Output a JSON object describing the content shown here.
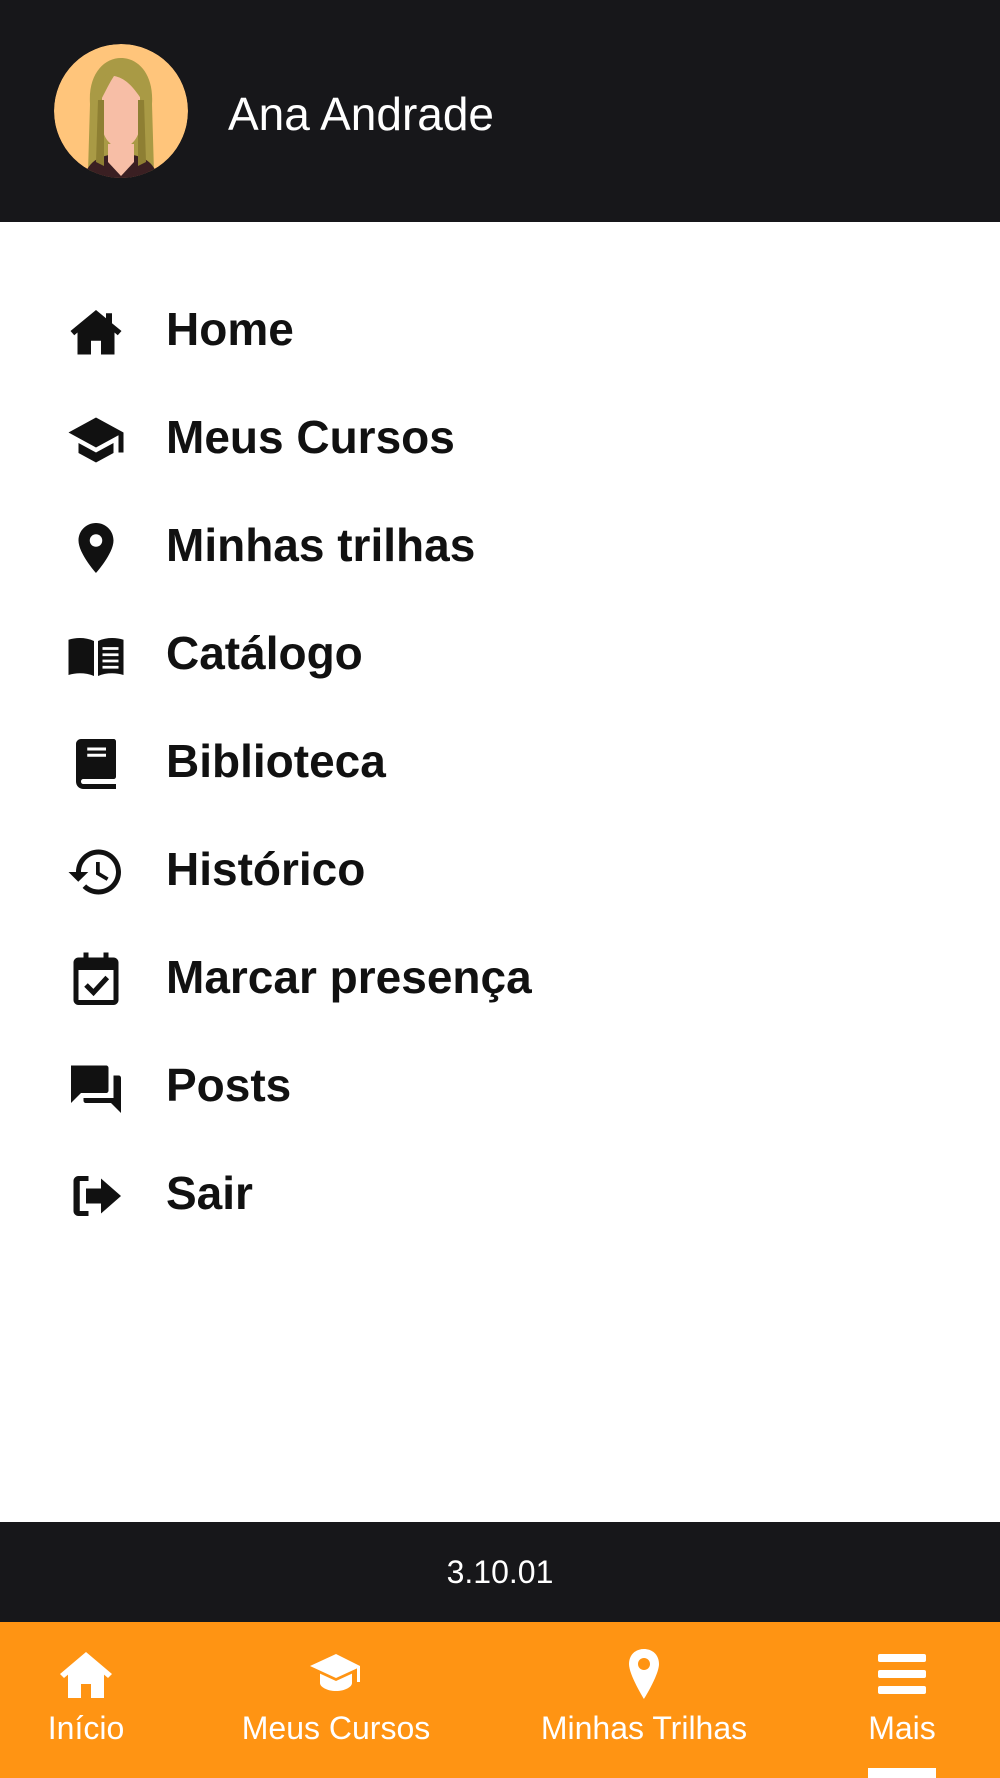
{
  "header": {
    "user_name": "Ana Andrade"
  },
  "menu": {
    "items": [
      {
        "label": "Home",
        "icon": "home-icon"
      },
      {
        "label": "Meus Cursos",
        "icon": "graduation-cap-icon"
      },
      {
        "label": "Minhas trilhas",
        "icon": "map-pin-icon"
      },
      {
        "label": "Catálogo",
        "icon": "open-book-icon"
      },
      {
        "label": "Biblioteca",
        "icon": "book-icon"
      },
      {
        "label": "Histórico",
        "icon": "history-icon"
      },
      {
        "label": "Marcar presença",
        "icon": "calendar-check-icon"
      },
      {
        "label": "Posts",
        "icon": "forum-icon"
      },
      {
        "label": "Sair",
        "icon": "sign-out-icon"
      }
    ]
  },
  "footer": {
    "version": "3.10.01"
  },
  "bottom_nav": {
    "tabs": [
      {
        "label": "Início",
        "icon": "home-icon"
      },
      {
        "label": "Meus Cursos",
        "icon": "graduation-cap-icon"
      },
      {
        "label": "Minhas Trilhas",
        "icon": "map-pin-icon"
      },
      {
        "label": "Mais",
        "icon": "menu-icon",
        "active": true
      }
    ]
  },
  "colors": {
    "header_bg": "#17171a",
    "accent": "#ff9413",
    "text": "#111111"
  }
}
